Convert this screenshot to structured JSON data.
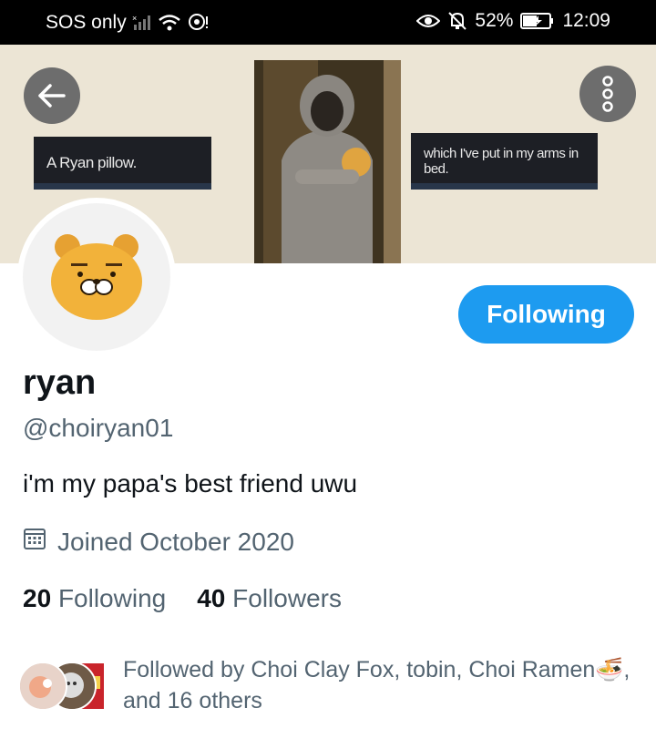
{
  "status_bar": {
    "carrier": "SOS only",
    "battery": "52%",
    "time": "12:09"
  },
  "header": {
    "banner_caption_left": "A Ryan pillow.",
    "banner_caption_right": "which I've put in my arms in bed.",
    "back_icon": "arrow-left-icon",
    "more_icon": "more-vertical-icon"
  },
  "profile": {
    "name": "ryan",
    "handle": "@choiryan01",
    "bio": "i'm my papa's best friend uwu",
    "joined": "Joined October 2020",
    "follow_button": "Following",
    "following_count": "20",
    "following_label": "Following",
    "followers_count": "40",
    "followers_label": "Followers",
    "followed_by": "Followed by Choi Clay Fox, tobin, Choi Ramen🍜, and 16 others"
  },
  "colors": {
    "accent": "#1d9bf0",
    "banner_bg": "#ece5d5",
    "secondary_text": "#536471"
  }
}
